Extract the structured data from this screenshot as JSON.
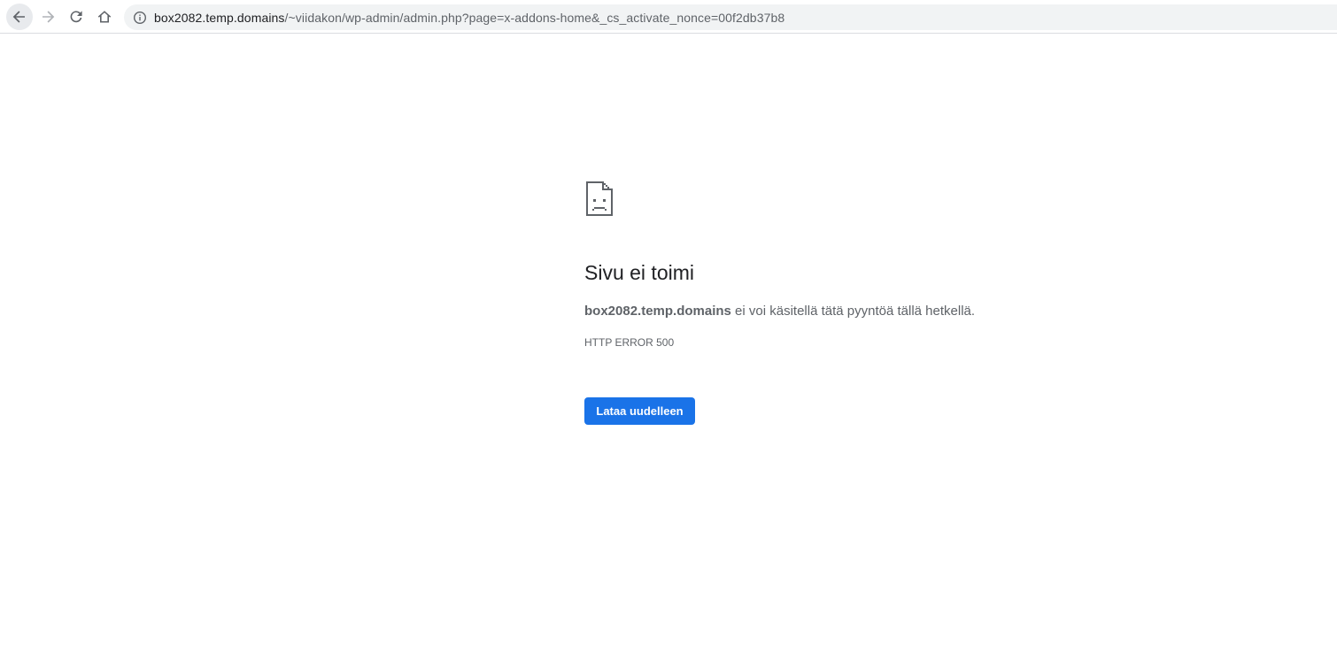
{
  "browser": {
    "url_host": "box2082.temp.domains",
    "url_path": "/~viidakon/wp-admin/admin.php?page=x-addons-home&_cs_activate_nonce=00f2db37b8",
    "icons": {
      "back": "back-arrow-icon",
      "forward": "forward-arrow-icon",
      "reload": "reload-icon",
      "home": "home-icon",
      "site_info": "info-icon"
    }
  },
  "error_page": {
    "icon": "sad-page-icon",
    "title": "Sivu ei toimi",
    "host": "box2082.temp.domains",
    "message_rest": " ei voi käsitellä tätä pyyntöä tällä hetkellä.",
    "error_code": "HTTP ERROR 500",
    "reload_label": "Lataa uudelleen"
  },
  "colors": {
    "accent": "#1a73e8",
    "text_primary": "#202124",
    "text_secondary": "#5f6368",
    "omnibox_bg": "#f1f3f4"
  }
}
